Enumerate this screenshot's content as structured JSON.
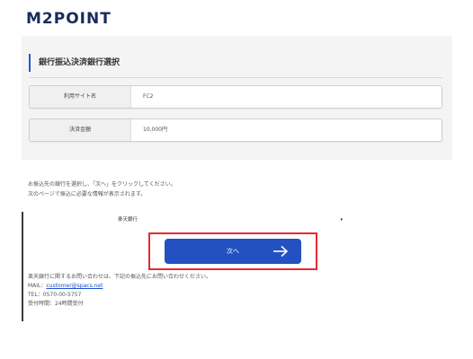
{
  "brand": {
    "logo": "M2POINT"
  },
  "section": {
    "title": "銀行振込決済銀行選択"
  },
  "info_rows": [
    {
      "label": "利用サイト名",
      "value": "FC2"
    },
    {
      "label": "決済金額",
      "value": "10,000円"
    }
  ],
  "instructions": {
    "line1": "お振込先の銀行を選択し、「次へ」をクリックしてください。",
    "line2": "次のページで振込に必要な情報が表示されます。"
  },
  "bank_select": {
    "selected": "楽天銀行"
  },
  "next_button": {
    "label": "次へ",
    "icon": "arrow-right-icon"
  },
  "contact": {
    "intro": "楽天銀行に関するお問い合わせは、下記の振込先にお問い合わせください。",
    "mail_label": "MAIL：",
    "mail": "customer@spacs.net",
    "tel": "TEL：0570-00-5757",
    "hours": "受付時間：24時間受付"
  },
  "colors": {
    "accent": "#2351c1",
    "highlight": "#e52a33",
    "logo": "#1a2b5c"
  }
}
